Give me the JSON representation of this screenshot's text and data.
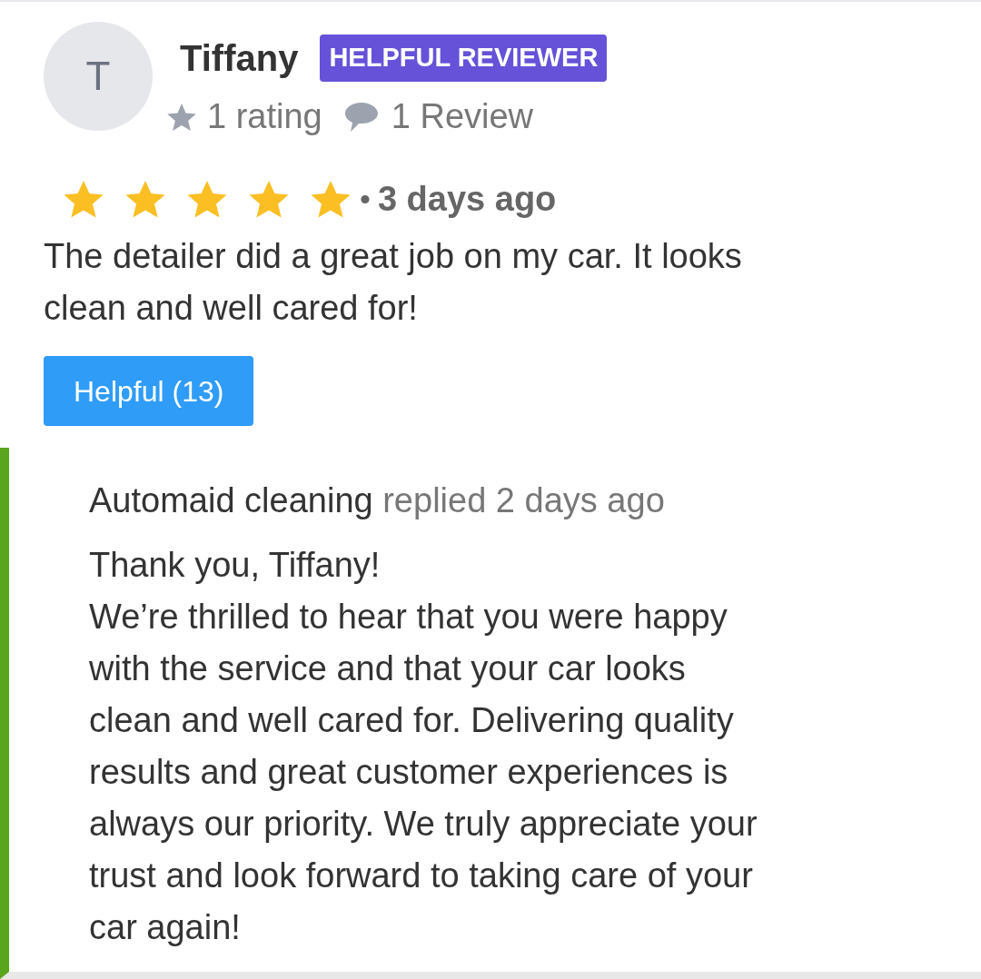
{
  "review": {
    "avatar_initial": "T",
    "author": "Tiffany",
    "badge": "HELPFUL REVIEWER",
    "ratings_count": "1 rating",
    "reviews_count": "1 Review",
    "stars": 5,
    "bullet": "•",
    "time": "3 days ago",
    "text": "The detailer did a great job on my car. It looks clean and well cared for!",
    "helpful_button": "Helpful (13)"
  },
  "reply": {
    "author": "Automaid cleaning",
    "meta": "replied 2 days ago",
    "greeting": "Thank you, Tiffany!",
    "body": "We’re thrilled to hear that you were happy with the service and that your car looks clean and well cared for. Delivering quality results and great customer experiences is always our priority. We truly appreciate your trust and look forward to taking care of your car again!"
  }
}
